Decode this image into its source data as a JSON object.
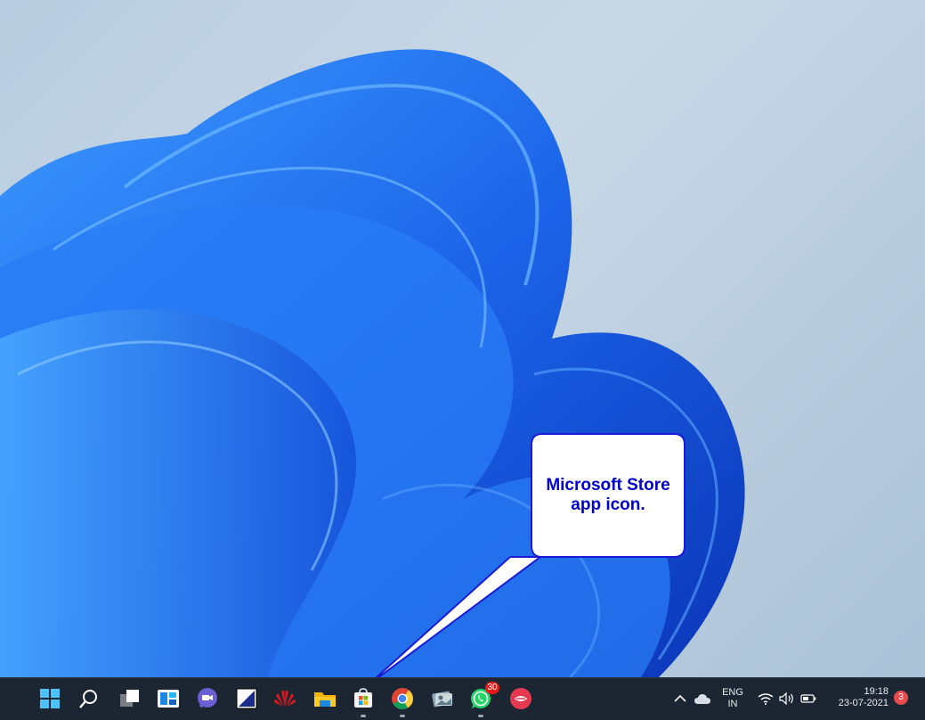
{
  "callout": {
    "line1": "Microsoft Store",
    "line2": "app icon."
  },
  "taskbar": {
    "apps": [
      {
        "name": "start-button",
        "icon": "windows-logo-icon"
      },
      {
        "name": "search-button",
        "icon": "search-icon"
      },
      {
        "name": "task-view-button",
        "icon": "task-view-icon"
      },
      {
        "name": "widgets-button",
        "icon": "widgets-icon"
      },
      {
        "name": "teams-chat-button",
        "icon": "teams-chat-icon"
      },
      {
        "name": "app-button",
        "icon": "app-square-icon"
      },
      {
        "name": "huawei-button",
        "icon": "huawei-icon"
      },
      {
        "name": "file-explorer-button",
        "icon": "folder-icon"
      },
      {
        "name": "microsoft-store-button",
        "icon": "store-bag-icon",
        "running": true
      },
      {
        "name": "chrome-button",
        "icon": "chrome-icon",
        "running": true
      },
      {
        "name": "photos-app-button",
        "icon": "photos-icon"
      },
      {
        "name": "whatsapp-button",
        "icon": "whatsapp-icon",
        "badge": "30",
        "running": true
      },
      {
        "name": "red-app-button",
        "icon": "red-app-icon"
      }
    ],
    "tray": {
      "language_top": "ENG",
      "language_bottom": "IN",
      "time": "19:18",
      "date": "23-07-2021",
      "notification_count": "3"
    }
  },
  "colors": {
    "taskbar_bg": "#1c2632",
    "callout_text": "#0000cc",
    "wallpaper_blue": "#1a5fe0"
  }
}
